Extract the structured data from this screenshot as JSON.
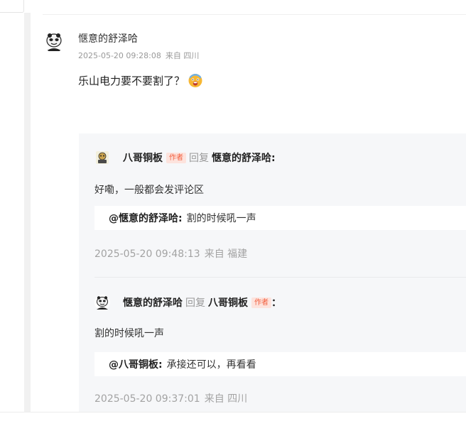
{
  "main_comment": {
    "username": "惬意的舒泽哈",
    "timestamp": "2025-05-20 09:28:08",
    "location": "来自 四川",
    "text": "乐山电力要不要割了？",
    "emoji": "scared-face-emoji"
  },
  "replies": [
    {
      "author": "八哥铜板",
      "author_tag": "作者",
      "reply_word": "回复",
      "target": "惬意的舒泽哈:",
      "text": "好嘞，一般都会发评论区",
      "quote_user": "@惬意的舒泽哈:",
      "quote_text": "割的时候吼一声",
      "timestamp": "2025-05-20 09:48:13",
      "location": "来自 福建"
    },
    {
      "author": "惬意的舒泽哈",
      "reply_word": "回复",
      "target": "八哥铜板",
      "target_tag": "作者",
      "colon": "：",
      "text": "割的时候吼一声",
      "quote_user": "@八哥铜板:",
      "quote_text": "承接还可以，再看看",
      "timestamp": "2025-05-20 09:37:01",
      "location": "来自 四川"
    }
  ],
  "colors": {
    "author_tag_text": "#f25d3c",
    "author_tag_bg": "#fde3dd",
    "panel_bg": "#f6f7f9",
    "meta_gray": "#999999"
  }
}
